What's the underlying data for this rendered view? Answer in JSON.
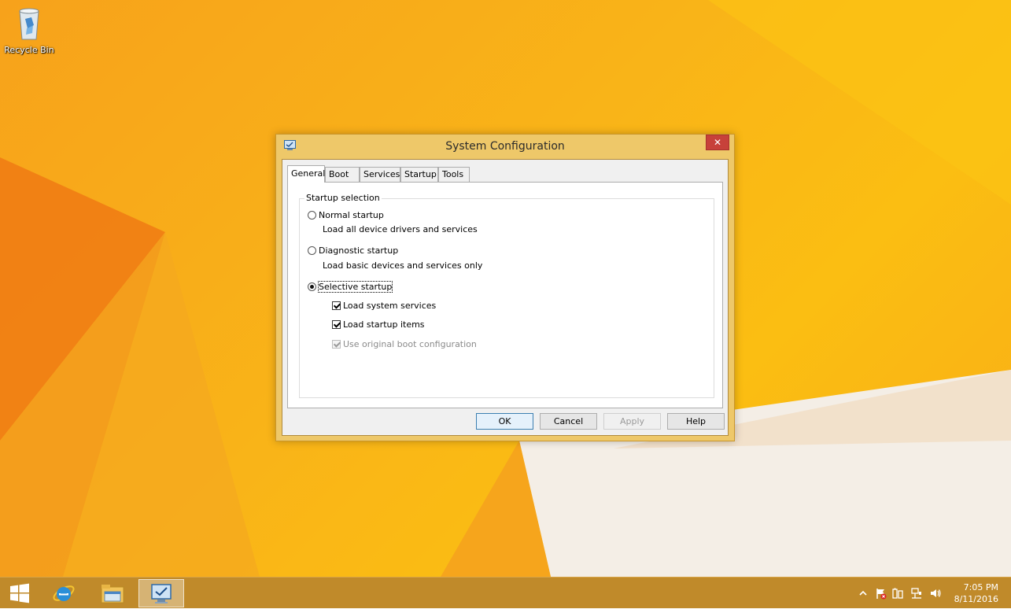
{
  "desktop": {
    "icons": [
      {
        "label": "Recycle Bin",
        "icon": "recycle-bin-icon"
      }
    ]
  },
  "dialog": {
    "title": "System Configuration",
    "close_label": "✕",
    "tabs": [
      {
        "label": "General",
        "active": true
      },
      {
        "label": "Boot"
      },
      {
        "label": "Services"
      },
      {
        "label": "Startup"
      },
      {
        "label": "Tools"
      }
    ],
    "startup_selection": {
      "group_label": "Startup selection",
      "normal": {
        "label": "Normal startup",
        "description": "Load all device drivers and services",
        "selected": false
      },
      "diagnostic": {
        "label": "Diagnostic startup",
        "description": "Load basic devices and services only",
        "selected": false
      },
      "selective": {
        "label": "Selective startup",
        "selected": true
      },
      "load_system_services": {
        "label": "Load system services",
        "checked": true
      },
      "load_startup_items": {
        "label": "Load startup items",
        "checked": true
      },
      "use_original_boot": {
        "label": "Use original boot configuration",
        "checked": true,
        "disabled": true
      }
    },
    "buttons": {
      "ok": "OK",
      "cancel": "Cancel",
      "apply": "Apply",
      "help": "Help"
    }
  },
  "taskbar": {
    "items": [
      {
        "icon": "windows-start-icon"
      },
      {
        "icon": "internet-explorer-icon"
      },
      {
        "icon": "file-explorer-icon"
      },
      {
        "icon": "system-configuration-icon",
        "active": true
      }
    ],
    "tray": {
      "icons": [
        "show-hidden-icons-chevron",
        "action-center-flag-icon",
        "power-icon",
        "network-icon",
        "volume-icon"
      ],
      "time": "7:05 PM",
      "date": "8/11/2016"
    }
  },
  "colors": {
    "desktop_bg": "#f9b418",
    "taskbar": "#c08a2a",
    "dialog_frame": "#eec869",
    "close_button": "#c7413a"
  }
}
